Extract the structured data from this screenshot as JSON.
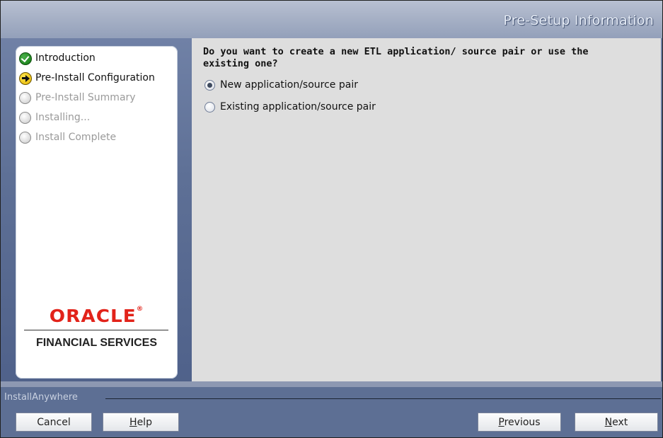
{
  "window": {
    "title": "Pre-Setup Information"
  },
  "steps": [
    {
      "label": "Introduction",
      "state": "done",
      "icon": "check-circle-icon"
    },
    {
      "label": "Pre-Install Configuration",
      "state": "current",
      "icon": "arrow-circle-icon"
    },
    {
      "label": "Pre-Install Summary",
      "state": "pending",
      "icon": "empty-circle-icon"
    },
    {
      "label": "Installing...",
      "state": "pending",
      "icon": "empty-circle-icon"
    },
    {
      "label": "Install Complete",
      "state": "pending",
      "icon": "empty-circle-icon"
    }
  ],
  "branding": {
    "logo_text": "ORACLE",
    "logo_mark": "®",
    "subtitle": "FINANCIAL SERVICES",
    "logo_color": "#e2231a"
  },
  "question": "Do you want to create a new ETL application/ source pair or use the existing one?",
  "options": [
    {
      "label": "New application/source pair",
      "selected": true
    },
    {
      "label": "Existing application/source pair",
      "selected": false
    }
  ],
  "footer": {
    "brand": "InstallAnywhere",
    "buttons": {
      "cancel": "Cancel",
      "help_prefix": "",
      "help_mnemonic": "H",
      "help_rest": "elp",
      "previous_mnemonic": "P",
      "previous_rest": "revious",
      "next_mnemonic": "N",
      "next_rest": "ext"
    }
  }
}
